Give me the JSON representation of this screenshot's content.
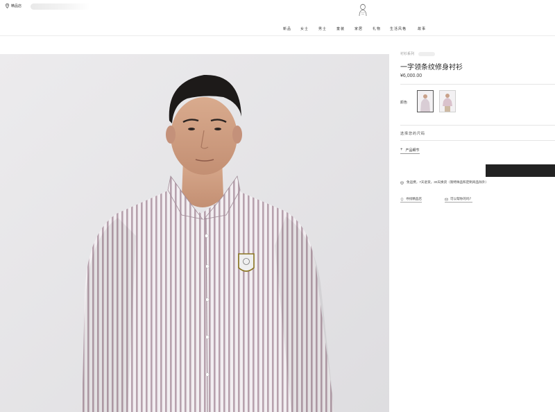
{
  "header": {
    "store_locator": "精品店",
    "nav": [
      "新品",
      "女士",
      "男士",
      "童装",
      "家居",
      "礼物",
      "生活风格",
      "故事"
    ]
  },
  "product": {
    "category": "衬衫系列",
    "title": "一字领条纹修身衬衫",
    "price": "¥6,000.00",
    "color_label": "颜色",
    "size_label": "选择您的尺码",
    "details_label": "产品细节",
    "shipping_note": "免运费，7天退货，30天换货（限特殊品和定制商品除外）",
    "store_link": "寻找精品店",
    "contact_link": "可以帮你的吗？"
  },
  "colors": {
    "accent": "#222222",
    "hero_bg": "#e8e7e9",
    "stripe": "#b7a1ad"
  },
  "icons": [
    "map-pin-icon",
    "logo-emblem",
    "plus-icon",
    "package-icon",
    "location-icon",
    "chat-icon"
  ]
}
